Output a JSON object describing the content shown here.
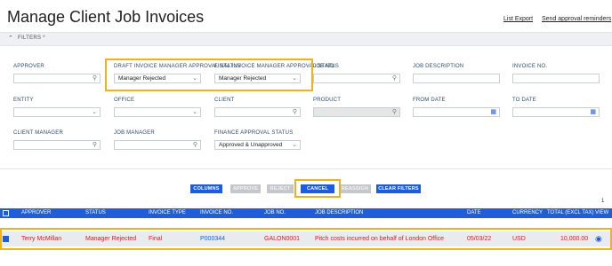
{
  "header": {
    "title": "Manage Client Job Invoices",
    "list_export": "List Export",
    "send_reminders": "Send approval reminders"
  },
  "filters": {
    "toggle_label": "FILTERS *",
    "approver": {
      "label": "APPROVER",
      "value": ""
    },
    "draft_status": {
      "label": "DRAFT INVOICE MANAGER APPROVAL STATUS",
      "value": "Manager Rejected"
    },
    "final_status": {
      "label": "FINAL INVOICE MANAGER APPROVAL STATUS",
      "value": "Manager Rejected"
    },
    "job_no": {
      "label": "JOB NO.",
      "value": ""
    },
    "job_description": {
      "label": "JOB DESCRIPTION",
      "value": ""
    },
    "invoice_no": {
      "label": "INVOICE NO.",
      "value": ""
    },
    "entity": {
      "label": "ENTITY",
      "value": ""
    },
    "office": {
      "label": "OFFICE",
      "value": ""
    },
    "client": {
      "label": "CLIENT",
      "value": ""
    },
    "product": {
      "label": "PRODUCT",
      "value": ""
    },
    "from_date": {
      "label": "FROM DATE",
      "value": ""
    },
    "to_date": {
      "label": "TO DATE",
      "value": ""
    },
    "client_manager": {
      "label": "CLIENT MANAGER",
      "value": ""
    },
    "job_manager": {
      "label": "JOB MANAGER",
      "value": ""
    },
    "finance_status": {
      "label": "FINANCE APPROVAL STATUS",
      "value": "Approved & Unapproved"
    }
  },
  "actions": {
    "columns": "COLUMNS",
    "approve": "APPROVE",
    "reject": "REJECT",
    "cancel": "CANCEL",
    "reassign": "REASSIGN",
    "clear_filters": "CLEAR FILTERS"
  },
  "pagination": {
    "page": "1"
  },
  "table": {
    "columns": [
      "APPROVER",
      "STATUS",
      "INVOICE TYPE",
      "INVOICE NO.",
      "JOB NO.",
      "JOB DESCRIPTION",
      "DATE",
      "CURRENCY",
      "TOTAL (EXCL TAX)",
      "VIEW"
    ],
    "rows": [
      {
        "approver": "Terry McMillan",
        "status": "Manager Rejected",
        "invoice_type": "Final",
        "invoice_no": "P000344",
        "job_no": "GALON0001",
        "job_description": "Pitch costs incurred on behalf of London Office",
        "date": "05/03/22",
        "currency": "USD",
        "total": "10,000.00",
        "selected": true
      }
    ]
  },
  "colors": {
    "accent": "#1a5de0",
    "highlight": "#f0b21a",
    "rejected": "#d42020"
  },
  "icons": {
    "search": "search-icon",
    "dropdown": "chevron-down-icon",
    "calendar": "calendar-icon",
    "view": "eye-icon"
  }
}
